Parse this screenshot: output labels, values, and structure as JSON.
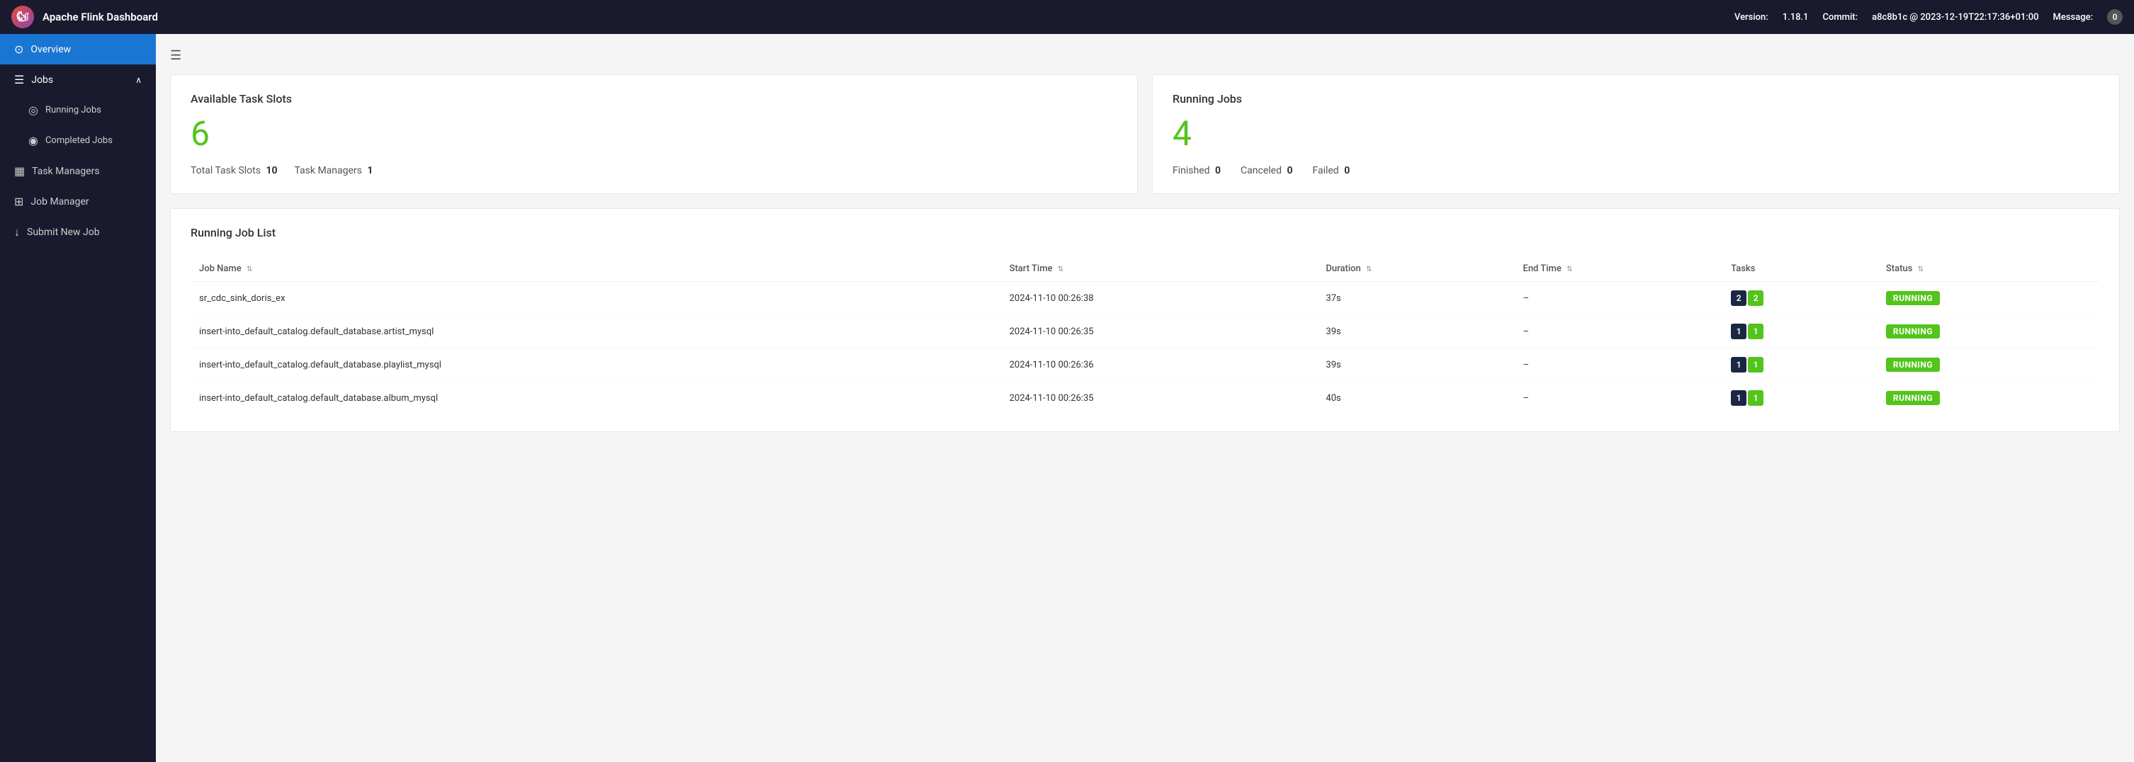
{
  "topbar": {
    "app_title": "Apache Flink Dashboard",
    "version_label": "Version:",
    "version_value": "1.18.1",
    "commit_label": "Commit:",
    "commit_value": "a8c8b1c @ 2023-12-19T22:17:36+01:00",
    "message_label": "Message:",
    "message_count": "0"
  },
  "sidebar": {
    "overview_label": "Overview",
    "jobs_label": "Jobs",
    "running_jobs_label": "Running Jobs",
    "completed_jobs_label": "Completed Jobs",
    "task_managers_label": "Task Managers",
    "job_manager_label": "Job Manager",
    "submit_new_job_label": "Submit New Job"
  },
  "overview": {
    "available_slots_title": "Available Task Slots",
    "available_slots_count": "6",
    "total_task_slots_label": "Total Task Slots",
    "total_task_slots_value": "10",
    "task_managers_label": "Task Managers",
    "task_managers_value": "1",
    "running_jobs_title": "Running Jobs",
    "running_jobs_count": "4",
    "finished_label": "Finished",
    "finished_value": "0",
    "canceled_label": "Canceled",
    "canceled_value": "0",
    "failed_label": "Failed",
    "failed_value": "0"
  },
  "running_job_list": {
    "title": "Running Job List",
    "columns": {
      "job_name": "Job Name",
      "start_time": "Start Time",
      "duration": "Duration",
      "end_time": "End Time",
      "tasks": "Tasks",
      "status": "Status"
    },
    "rows": [
      {
        "job_name": "sr_cdc_sink_doris_ex",
        "start_time": "2024-11-10 00:26:38",
        "duration": "37s",
        "end_time": "–",
        "tasks_blue": "2",
        "tasks_green": "2",
        "status": "RUNNING"
      },
      {
        "job_name": "insert-into_default_catalog.default_database.artist_mysql",
        "start_time": "2024-11-10 00:26:35",
        "duration": "39s",
        "end_time": "–",
        "tasks_blue": "1",
        "tasks_green": "1",
        "status": "RUNNING"
      },
      {
        "job_name": "insert-into_default_catalog.default_database.playlist_mysql",
        "start_time": "2024-11-10 00:26:36",
        "duration": "39s",
        "end_time": "–",
        "tasks_blue": "1",
        "tasks_green": "1",
        "status": "RUNNING"
      },
      {
        "job_name": "insert-into_default_catalog.default_database.album_mysql",
        "start_time": "2024-11-10 00:26:35",
        "duration": "40s",
        "end_time": "–",
        "tasks_blue": "1",
        "tasks_green": "1",
        "status": "RUNNING"
      }
    ]
  }
}
